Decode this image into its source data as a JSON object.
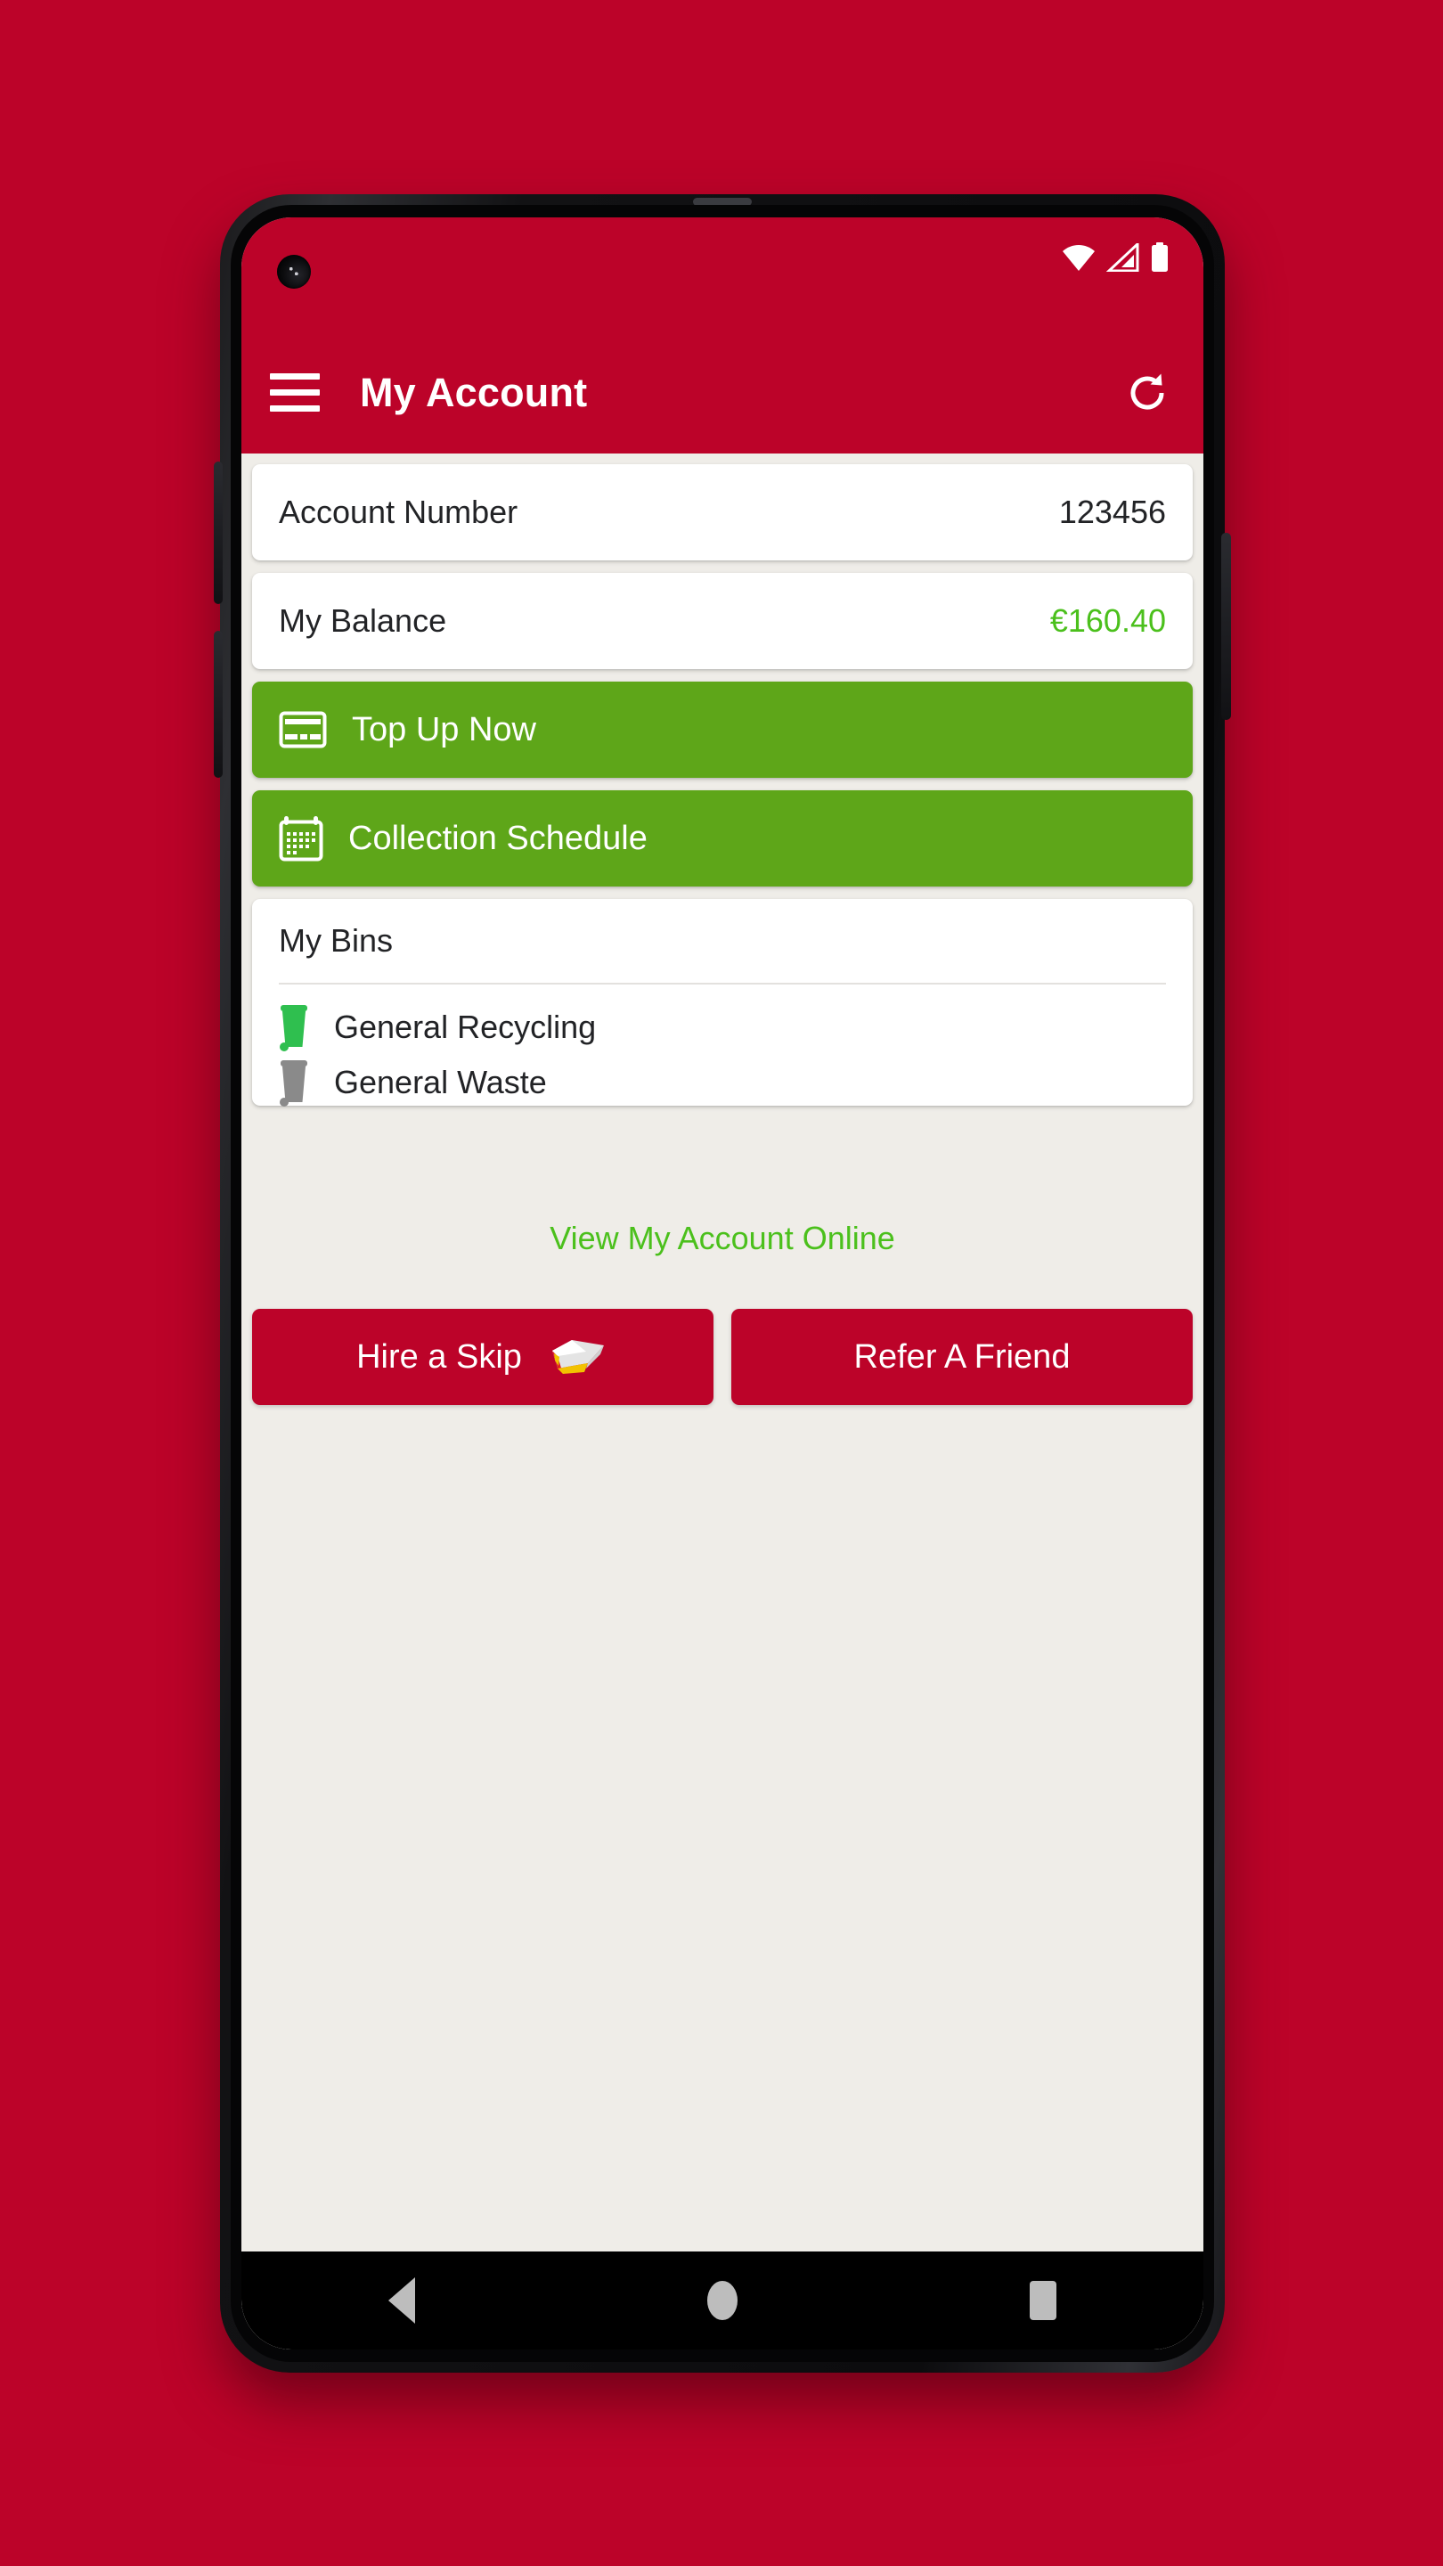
{
  "theme": {
    "brand_red": "#BC0329",
    "accent_green": "#5EA619",
    "value_green": "#4BC01C",
    "page_background": "#EFEDE8",
    "card_background": "#FFFFFF",
    "bin_recycling_color": "#2FBF4F",
    "bin_waste_color": "#8A8A8A"
  },
  "status_bar": {
    "wifi_icon": "wifi-icon",
    "signal_icon": "cellular-signal-icon",
    "battery_icon": "battery-full-icon",
    "camera": "front-camera"
  },
  "app_bar": {
    "menu_icon": "hamburger-menu-icon",
    "title": "My Account",
    "refresh_icon": "refresh-icon"
  },
  "account": {
    "number_label": "Account Number",
    "number_value": "123456",
    "balance_label": "My Balance",
    "balance_value": "€160.40"
  },
  "actions": [
    {
      "label": "Top Up Now",
      "icon": "credit-card-icon"
    },
    {
      "label": "Collection Schedule",
      "icon": "calendar-icon"
    }
  ],
  "my_bins": {
    "title": "My Bins",
    "items": [
      {
        "label": "General Recycling",
        "icon": "wheelie-bin-green-icon"
      },
      {
        "label": "General Waste",
        "icon": "wheelie-bin-grey-icon"
      }
    ]
  },
  "links": {
    "view_account_online": "View My Account Online"
  },
  "bottom_buttons": [
    {
      "label": "Hire a Skip",
      "icon": "skip-container-icon"
    },
    {
      "label": "Refer A Friend",
      "icon": ""
    }
  ],
  "navigation_bar": {
    "back": "back-button",
    "home": "home-button",
    "recents": "recent-apps-button"
  }
}
